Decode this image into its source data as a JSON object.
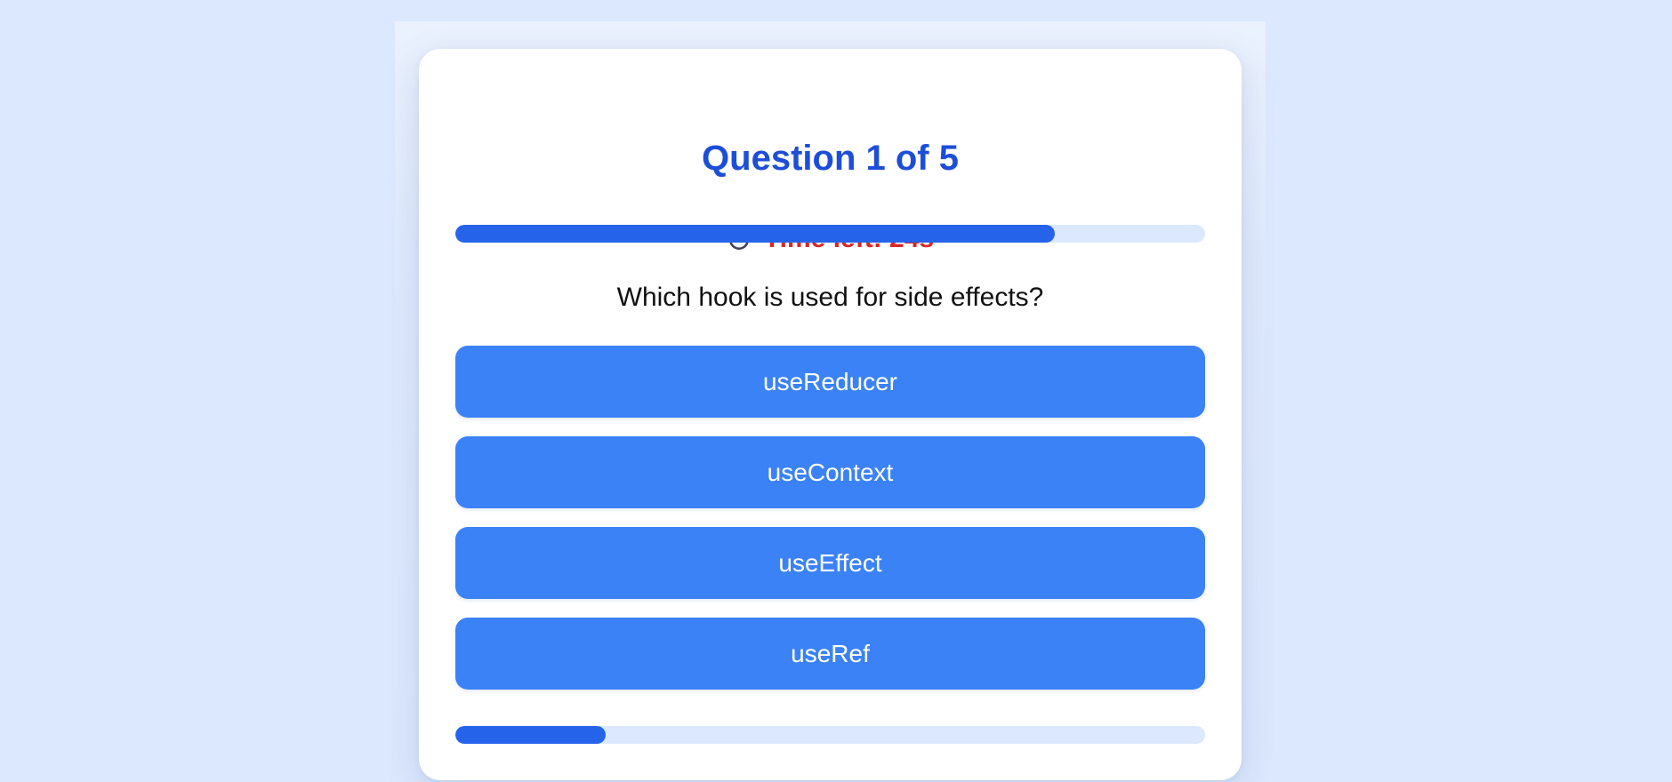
{
  "quiz": {
    "title": "Question 1 of 5",
    "timer": {
      "icon": "stopwatch-icon",
      "label": "Time left: 24s",
      "remaining_fraction": 0.8
    },
    "question": "Which hook is used for side effects?",
    "options": [
      {
        "label": "useReducer"
      },
      {
        "label": "useContext"
      },
      {
        "label": "useEffect"
      },
      {
        "label": "useRef"
      }
    ],
    "progress": {
      "completed_fraction": 0.2
    }
  },
  "colors": {
    "background": "#dbe8fd",
    "title": "#1d4ed8",
    "timer_text": "#dc2626",
    "bar_fill": "#2563eb",
    "bar_track": "#dbe8fd",
    "option_button": "#3b82f6",
    "option_text": "#ffffff"
  }
}
